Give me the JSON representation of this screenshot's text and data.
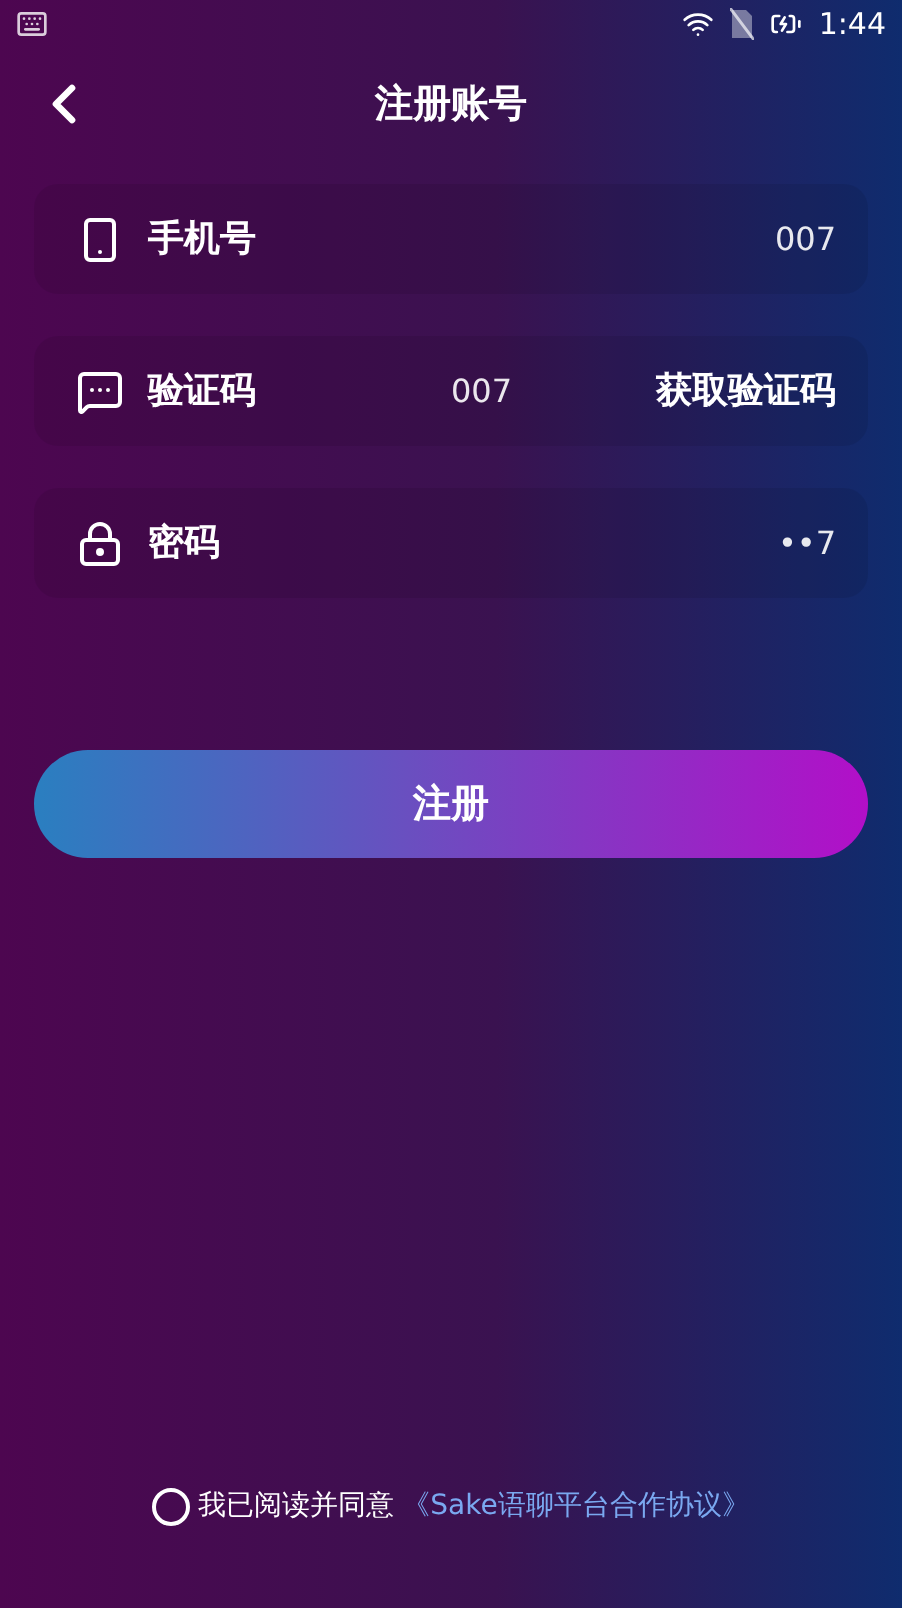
{
  "status_bar": {
    "time": "1:44"
  },
  "header": {
    "title": "注册账号"
  },
  "fields": [
    {
      "kind": "phone",
      "label": "手机号",
      "value": "007"
    },
    {
      "kind": "code",
      "label": "验证码",
      "value": "007",
      "action": "获取验证码"
    },
    {
      "kind": "password",
      "label": "密码",
      "value": "••7"
    }
  ],
  "submit": "注册",
  "agreement": {
    "checked": false,
    "text": "我已阅读并同意",
    "link": "《Sake语聊平台合作协议》"
  }
}
